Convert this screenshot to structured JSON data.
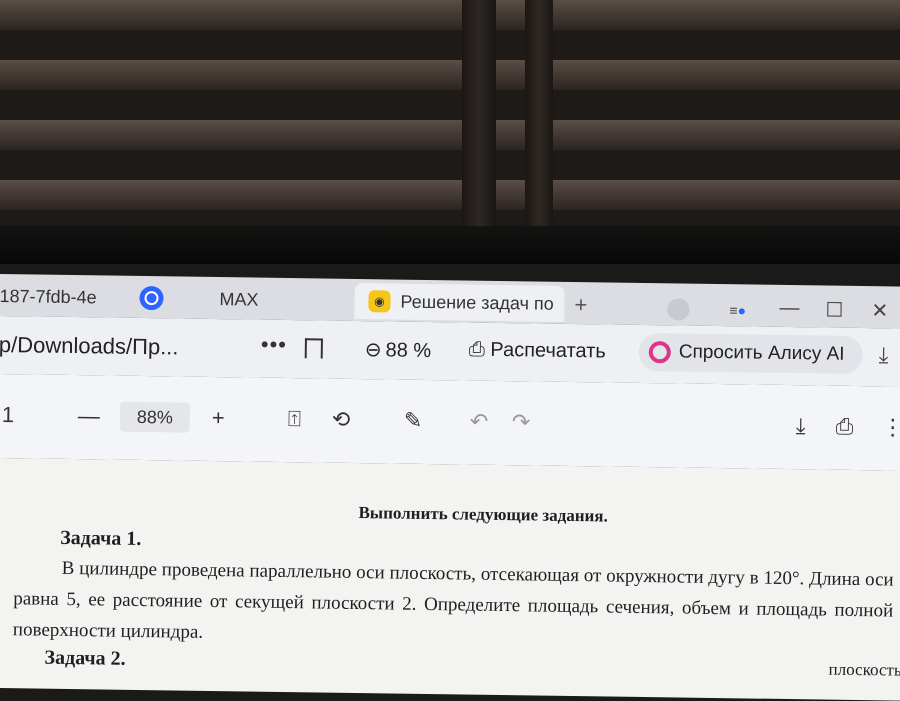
{
  "tabs": [
    {
      "label": "187-7fdb-4e"
    },
    {
      "icon": "max-messenger-icon"
    },
    {
      "label": "MAX"
    },
    {
      "label": "Решение задач по",
      "icon": "yandex-tab-icon"
    }
  ],
  "new_tab": "+",
  "window_controls": {
    "minimize": "—",
    "maximize": "☐",
    "close": "✕"
  },
  "address_bar": {
    "url": "p/Downloads/Пр...",
    "more": "•••",
    "zoom": "88 %",
    "print_label": "Распечатать",
    "alice_label": "Спросить Алису AI"
  },
  "pdf_toolbar": {
    "page": "1",
    "zoom_out": "—",
    "zoom": "88%",
    "zoom_in": "+"
  },
  "document": {
    "heading": "Выполнить следующие задания.",
    "task1_title": "Задача 1.",
    "task1_text": "В цилиндре проведена параллельно оси плоскость, отсекающая от окружности дугу в 120°. Длина оси равна 5, ее расстояние от секущей плоскости 2. Определите площадь сечения, объем и площадь полной поверхности цилиндра.",
    "task2_title": "Задача 2.",
    "task2_cut": "плоскостью"
  }
}
